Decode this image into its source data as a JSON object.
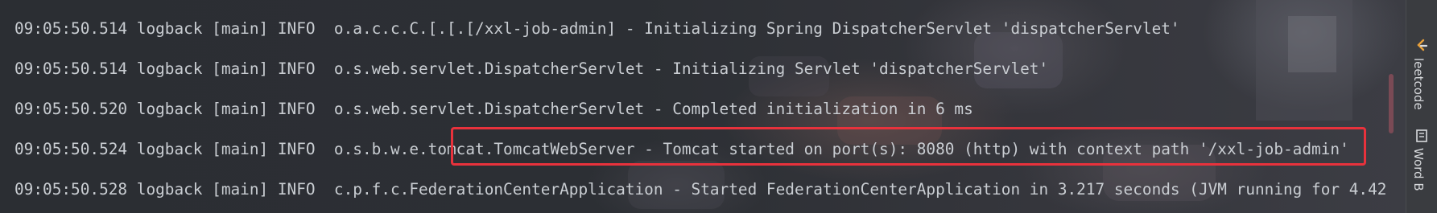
{
  "console": {
    "lines": [
      "09:05:50.514 logback [main] INFO  o.a.c.c.C.[.[.[/xxl-job-admin] - Initializing Spring DispatcherServlet 'dispatcherServlet'",
      "09:05:50.514 logback [main] INFO  o.s.web.servlet.DispatcherServlet - Initializing Servlet 'dispatcherServlet'",
      "09:05:50.520 logback [main] INFO  o.s.web.servlet.DispatcherServlet - Completed initialization in 6 ms",
      "09:05:50.524 logback [main] INFO  o.s.b.w.e.tomcat.TomcatWebServer - Tomcat started on port(s): 8080 (http) with context path '/xxl-job-admin'",
      "09:05:50.528 logback [main] INFO  c.p.f.c.FederationCenterApplication - Started FederationCenterApplication in 3.217 seconds (JVM running for 4.42"
    ],
    "highlight_color": "#e8323c",
    "text_color": "#c9cdd2",
    "background_color": "#2b2e33"
  },
  "side_panel": {
    "tabs": [
      {
        "label": "leetcode",
        "icon": "leetcode-icon"
      },
      {
        "label": "Word B",
        "icon": "word-book-icon"
      }
    ]
  }
}
